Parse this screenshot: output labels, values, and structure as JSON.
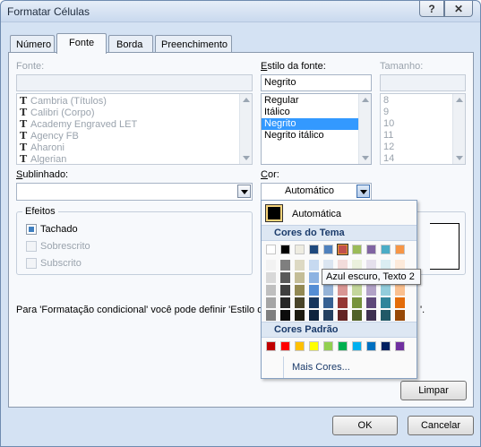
{
  "window": {
    "title": "Formatar Células",
    "help": "?",
    "close": "✕"
  },
  "tabs": [
    "Número",
    "Fonte",
    "Borda",
    "Preenchimento"
  ],
  "font": {
    "label": "Fonte:",
    "value": "",
    "items": [
      "Cambria (Títulos)",
      "Calibri (Corpo)",
      "Academy Engraved LET",
      "Agency FB",
      "Aharoni",
      "Algerian"
    ]
  },
  "style": {
    "label": "Estilo da fonte:",
    "value": "Negrito",
    "items": [
      "Regular",
      "Itálico",
      "Negrito",
      "Negrito itálico"
    ],
    "selected_index": 2
  },
  "size": {
    "label": "Tamanho:",
    "value": "",
    "items": [
      "8",
      "9",
      "10",
      "11",
      "12",
      "14"
    ]
  },
  "underline": {
    "label": "Sublinhado:",
    "value": ""
  },
  "color": {
    "label": "Cor:",
    "value": "Automático"
  },
  "effects": {
    "legend": "Efeitos",
    "items": [
      {
        "label": "Tachado",
        "checked": true,
        "enabled": true
      },
      {
        "label": "Sobrescrito",
        "checked": false,
        "enabled": false
      },
      {
        "label": "Subscrito",
        "checked": false,
        "enabled": false
      }
    ]
  },
  "note": "Para 'Formatação condicional' você pode definir 'Estilo da",
  "note_tail": "'.",
  "buttons": {
    "clear": "Limpar",
    "ok": "OK",
    "cancel": "Cancelar"
  },
  "color_popup": {
    "automatic": "Automática",
    "theme_header": "Cores do Tema",
    "standard_header": "Cores Padrão",
    "more": "Mais Cores...",
    "tooltip": "Azul escuro, Texto 2",
    "theme_top": [
      "#ffffff",
      "#000000",
      "#eeece1",
      "#1f497d",
      "#4f81bd",
      "#c0504d",
      "#9bbb59",
      "#8064a2",
      "#4bacc6",
      "#f79646"
    ],
    "theme_shades": [
      [
        "#f2f2f2",
        "#7f7f7f",
        "#ddd9c3",
        "#c6d9f0",
        "#dbe5f1",
        "#f2dcdb",
        "#ebf1dd",
        "#e5e0ec",
        "#dbeef3",
        "#fdeada"
      ],
      [
        "#d8d8d8",
        "#595959",
        "#c4bd97",
        "#8db3e2",
        "#b8cce4",
        "#e5b9b7",
        "#d7e3bc",
        "#ccc1d9",
        "#b7dde8",
        "#fbd5b5"
      ],
      [
        "#bfbfbf",
        "#3f3f3f",
        "#938953",
        "#548dd4",
        "#95b3d7",
        "#d99694",
        "#c3d69b",
        "#b2a2c7",
        "#92cddc",
        "#fac08f"
      ],
      [
        "#a5a5a5",
        "#262626",
        "#494429",
        "#17365d",
        "#366092",
        "#953734",
        "#76923c",
        "#5f497a",
        "#31859b",
        "#e36c09"
      ],
      [
        "#7f7f7f",
        "#0c0c0c",
        "#1d1b10",
        "#0f243e",
        "#244061",
        "#632423",
        "#4f6128",
        "#3f3151",
        "#205867",
        "#974806"
      ]
    ],
    "standard": [
      "#c00000",
      "#ff0000",
      "#ffc000",
      "#ffff00",
      "#92d050",
      "#00b050",
      "#00b0f0",
      "#0070c0",
      "#002060",
      "#7030a0"
    ],
    "selected_theme_index": 5
  }
}
